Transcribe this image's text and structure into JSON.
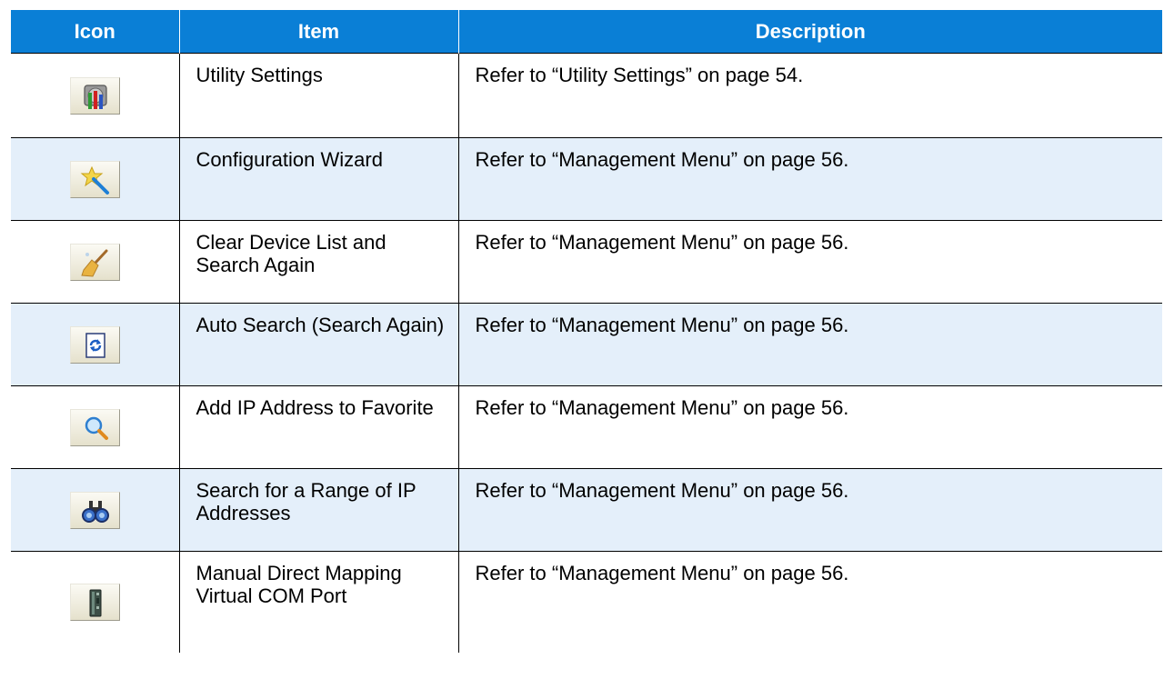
{
  "table": {
    "headers": [
      "Icon",
      "Item",
      "Description"
    ],
    "rows": [
      {
        "icon": "utility-settings-icon",
        "item": "Utility Settings",
        "description": "Refer to “Utility Settings” on page 54."
      },
      {
        "icon": "magic-wand-icon",
        "item": "Configuration Wizard",
        "description": "Refer to “Management Menu” on page 56."
      },
      {
        "icon": "broom-icon",
        "item": "Clear Device List and Search Again",
        "description": "Refer to “Management Menu” on page 56."
      },
      {
        "icon": "refresh-page-icon",
        "item": "Auto Search (Search Again)",
        "description": "Refer to “Management Menu” on page 56."
      },
      {
        "icon": "magnifier-icon",
        "item": "Add IP Address to Favorite",
        "description": "Refer to “Management Menu” on page 56."
      },
      {
        "icon": "binoculars-icon",
        "item": "Search for a Range of IP Addresses",
        "description": "Refer to “Management Menu” on page 56."
      },
      {
        "icon": "device-server-icon",
        "item": "Manual Direct Mapping Virtual COM Port",
        "description": "Refer to “Management Menu” on page 56."
      }
    ]
  }
}
